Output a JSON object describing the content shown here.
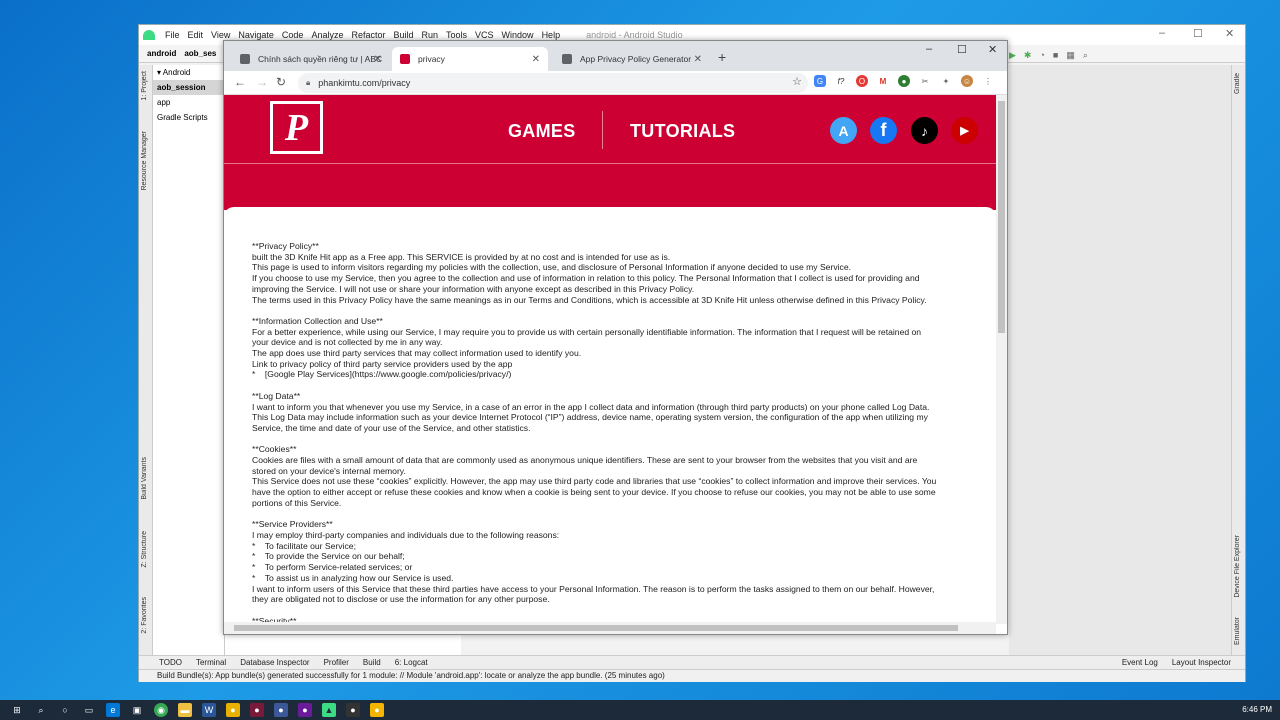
{
  "android_studio": {
    "menu": [
      "File",
      "Edit",
      "View",
      "Navigate",
      "Code",
      "Analyze",
      "Refactor",
      "Build",
      "Run",
      "Tools",
      "VCS",
      "Window",
      "Help"
    ],
    "window_title": "android - Android Studio",
    "nav": [
      "android",
      "aob_ses"
    ],
    "left_strip": [
      "1: Project",
      "Resource Manager",
      "Build Variants",
      "Z: Structure",
      "2: Favorites"
    ],
    "right_strip": [
      "Gradle",
      "Device File Explorer",
      "Emulator"
    ],
    "project_selector": "Android",
    "project_tree": [
      "aob_session",
      "app",
      "Gradle Scripts"
    ],
    "bottom_tabs": [
      "TODO",
      "Terminal",
      "Database Inspector",
      "Profiler",
      "Build",
      "6: Logcat"
    ],
    "bottom_tabs_right": [
      "Event Log",
      "Layout Inspector"
    ],
    "status": "Build Bundle(s): App bundle(s) generated successfully for 1 module: // Module 'android.app': locate or analyze the app bundle. (25 minutes ago)"
  },
  "chrome": {
    "tabs": [
      {
        "label": "Chính sách quyền riêng tư | ABC",
        "color": "#5f6368"
      },
      {
        "label": "privacy",
        "color": "#cc0033"
      },
      {
        "label": "App Privacy Policy Generator",
        "color": "#5f6368"
      }
    ],
    "url": "phankimtu.com/privacy",
    "new_tab": "+",
    "controls": {
      "minimize": "–",
      "maximize": "☐",
      "close": "✕"
    }
  },
  "site": {
    "logo_letter": "P",
    "nav": [
      "GAMES",
      "TUTORIALS"
    ],
    "brand_color": "#cc0033",
    "social": [
      {
        "icon": "app-store-icon",
        "glyph": "A",
        "color": "#1e88e5"
      },
      {
        "icon": "facebook-icon",
        "glyph": "f",
        "color": "#1877f2"
      },
      {
        "icon": "tiktok-icon",
        "glyph": "♪",
        "color": "#000000"
      },
      {
        "icon": "youtube-icon",
        "glyph": "▶",
        "color": "#cc0000"
      }
    ],
    "policy_text": "**Privacy Policy**\nbuilt the 3D Knife Hit app as a Free app. This SERVICE is provided by at no cost and is intended for use as is.\nThis page is used to inform visitors regarding my policies with the collection, use, and disclosure of Personal Information if anyone decided to use my Service.\nIf you choose to use my Service, then you agree to the collection and use of information in relation to this policy. The Personal Information that I collect is used for providing and\nimproving the Service. I will not use or share your information with anyone except as described in this Privacy Policy.\nThe terms used in this Privacy Policy have the same meanings as in our Terms and Conditions, which is accessible at 3D Knife Hit unless otherwise defined in this Privacy Policy.\n\n**Information Collection and Use**\nFor a better experience, while using our Service, I may require you to provide us with certain personally identifiable information. The information that I request will be retained on\nyour device and is not collected by me in any way.\nThe app does use third party services that may collect information used to identify you.\nLink to privacy policy of third party service providers used by the app\n*    [Google Play Services](https://www.google.com/policies/privacy/)\n\n**Log Data**\nI want to inform you that whenever you use my Service, in a case of an error in the app I collect data and information (through third party products) on your phone called Log Data.\nThis Log Data may include information such as your device Internet Protocol (“IP”) address, device name, operating system version, the configuration of the app when utilizing my\nService, the time and date of your use of the Service, and other statistics.\n\n**Cookies**\nCookies are files with a small amount of data that are commonly used as anonymous unique identifiers. These are sent to your browser from the websites that you visit and are\nstored on your device's internal memory.\nThis Service does not use these “cookies” explicitly. However, the app may use third party code and libraries that use “cookies” to collect information and improve their services. You\nhave the option to either accept or refuse these cookies and know when a cookie is being sent to your device. If you choose to refuse our cookies, you may not be able to use some\nportions of this Service.\n\n**Service Providers**\nI may employ third-party companies and individuals due to the following reasons:\n*    To facilitate our Service;\n*    To provide the Service on our behalf;\n*    To perform Service-related services; or\n*    To assist us in analyzing how our Service is used.\nI want to inform users of this Service that these third parties have access to your Personal Information. The reason is to perform the tasks assigned to them on our behalf. However,\nthey are obligated not to disclose or use the information for any other purpose.\n\n**Security**"
  },
  "taskbar": {
    "time": "6:46 PM",
    "icons": [
      {
        "name": "windows-start-icon",
        "glyph": "⊞",
        "color": "#1d2a3a"
      },
      {
        "name": "search-icon",
        "glyph": "⌕",
        "color": "#1d2a3a"
      },
      {
        "name": "cortana-icon",
        "glyph": "○",
        "color": "#1d2a3a"
      },
      {
        "name": "task-view-icon",
        "glyph": "▭",
        "color": "#1d2a3a"
      },
      {
        "name": "edge-icon",
        "glyph": "e",
        "color": "#0078d7"
      },
      {
        "name": "store-icon",
        "glyph": "▣",
        "color": "#1d2a3a"
      },
      {
        "name": "chrome-icon",
        "glyph": "◉",
        "color": "#34a853"
      },
      {
        "name": "explorer-icon",
        "glyph": "▬",
        "color": "#f0c040"
      },
      {
        "name": "word-icon",
        "glyph": "W",
        "color": "#2b579a"
      },
      {
        "name": "app-icon",
        "glyph": "●",
        "color": "#e8b000"
      },
      {
        "name": "app-icon",
        "glyph": "●",
        "color": "#7a1a3a"
      },
      {
        "name": "app-icon",
        "glyph": "●",
        "color": "#3b5998"
      },
      {
        "name": "app-icon",
        "glyph": "●",
        "color": "#6a1b9a"
      },
      {
        "name": "android-studio-icon",
        "glyph": "▲",
        "color": "#3ddc84"
      },
      {
        "name": "app-icon",
        "glyph": "●",
        "color": "#333333"
      },
      {
        "name": "app-icon",
        "glyph": "●",
        "color": "#f4b400"
      }
    ]
  }
}
